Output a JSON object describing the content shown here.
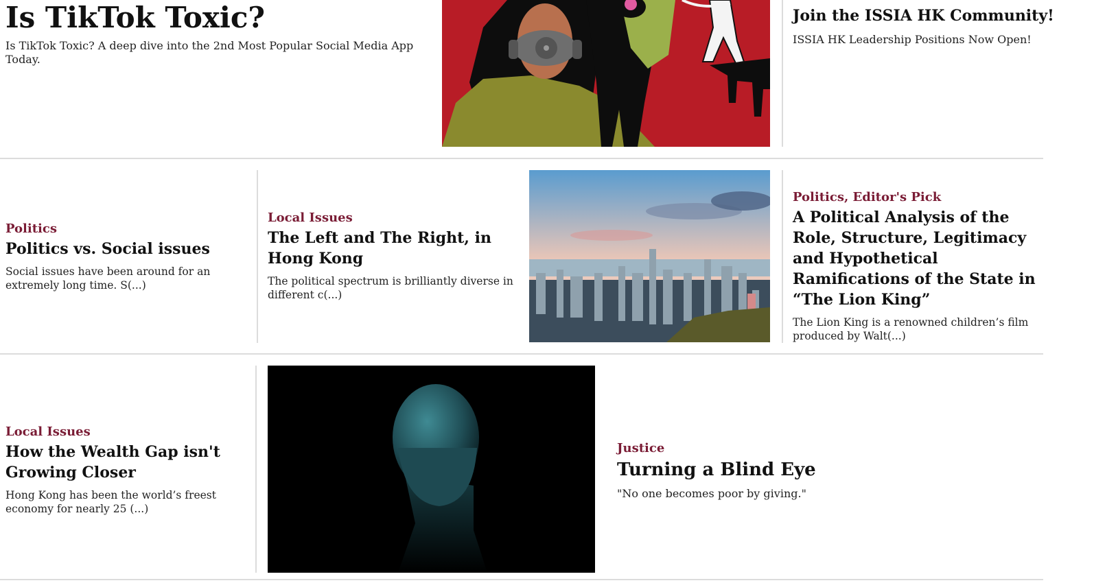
{
  "featured": {
    "title": "Is TikTok Toxic?",
    "excerpt": "Is TikTok Toxic? A deep dive into the 2nd Most Popular Social Media App Today."
  },
  "sidebar_top": {
    "title": "Join the ISSIA HK Community!",
    "excerpt": "ISSIA HK Leadership Positions Now Open!"
  },
  "row2": {
    "a": {
      "category": "Politics",
      "title": "Politics vs. Social issues",
      "excerpt": "Social issues have been around for an extremely long time. S(...)"
    },
    "b": {
      "category": "Local Issues",
      "title": "The Left and The Right, in Hong Kong",
      "excerpt": "The political spectrum is brilliantly diverse in different c(...)"
    },
    "c": {
      "category": "Politics, Editor's Pick",
      "title": "A Political Analysis of the Role, Structure, Legitimacy and Hypothetical Ramifications of the State in “The Lion King”",
      "excerpt": "The Lion King is a renowned children’s film produced by Walt(...)"
    }
  },
  "row3": {
    "a": {
      "category": "Local Issues",
      "title": "How the Wealth Gap isn't Growing Closer",
      "excerpt": "Hong Kong has been the world’s freest economy for nearly 25 (...)"
    },
    "b": {
      "category": "Justice",
      "title": "Turning a Blind Eye",
      "excerpt": "\"No one becomes poor by giving.\""
    }
  },
  "colors": {
    "accent": "#7a1c35",
    "divider": "#dcdcdc",
    "poster_red": "#b81c26"
  }
}
